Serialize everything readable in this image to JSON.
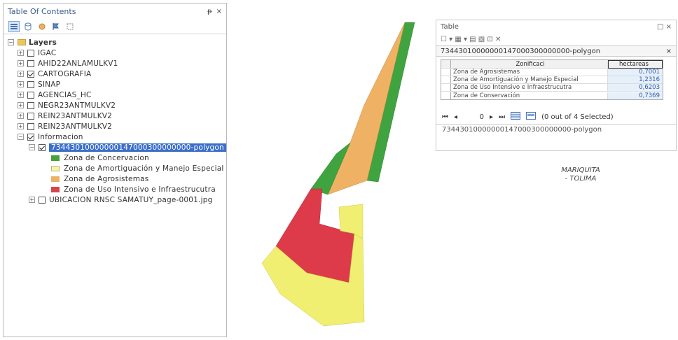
{
  "toc": {
    "title": "Table Of Contents",
    "pin": "ᵽ",
    "close": "×",
    "root_label": "Layers",
    "layers": [
      {
        "label": "IGAC",
        "checked": false
      },
      {
        "label": "AHID22ANLAMULKV1",
        "checked": false
      },
      {
        "label": "CARTOGRAFIA",
        "checked": true
      },
      {
        "label": "SINAP",
        "checked": false
      },
      {
        "label": "AGENCIAS_HC",
        "checked": false
      },
      {
        "label": "NEGR23ANTMULKV2",
        "checked": false
      },
      {
        "label": "REIN23ANTMULKV2",
        "checked": false
      },
      {
        "label": "REIN23ANTMULKV2",
        "checked": false
      }
    ],
    "group_label": "Informacion",
    "selected_layer": "73443010000000147000300000000-polygon",
    "legend": [
      {
        "label": "Zona de Concervacion",
        "color": "#49a13d"
      },
      {
        "label": "Zona de Amortiguación y Manejo Especial",
        "color": "#f5f3b0"
      },
      {
        "label": "Zona de Agrosistemas",
        "color": "#e9b36a"
      },
      {
        "label": "Zona de Uso Intensivo e Infraestrucutra",
        "color": "#d9444c"
      }
    ],
    "last_layer": "UBICACION RNSC SAMATUY_page-0001.jpg"
  },
  "map": {
    "colors": {
      "conservacion": "#3fa43f",
      "agrosistemas": "#efb164",
      "uso_intensivo": "#dd3b4a",
      "amortiguacion": "#f0ef72"
    }
  },
  "table": {
    "title": "Table",
    "window_ctrl": "□ ×",
    "toolbar_icons": "☐ ▾  ▦ ▾  ▤ ▧  ⊡ ✕",
    "layer_name": "73443010000000147000300000000-polygon",
    "layer_close": "×",
    "columns": [
      "Zonificaci",
      "hectareas"
    ],
    "rows": [
      {
        "zona": "Zona de Agrosistemas",
        "hectareas": "0,7001"
      },
      {
        "zona": "Zona de Amortiguación y Manejo Especial",
        "hectareas": "1,2316"
      },
      {
        "zona": "Zona de Uso Intensivo e Infraestrucutra",
        "hectareas": "0,6203"
      },
      {
        "zona": "Zona de Conservación",
        "hectareas": "0,7369"
      }
    ],
    "nav": {
      "first": "⏮",
      "prev": "◂",
      "record": "0",
      "next": "▸",
      "last": "⏭",
      "selected_text": "(0 out of 4 Selected)"
    },
    "status_tab": "73443010000000147000300000000-polygon"
  },
  "caption": {
    "line1": "MARIQUITA",
    "line2": "- TOLIMA"
  }
}
